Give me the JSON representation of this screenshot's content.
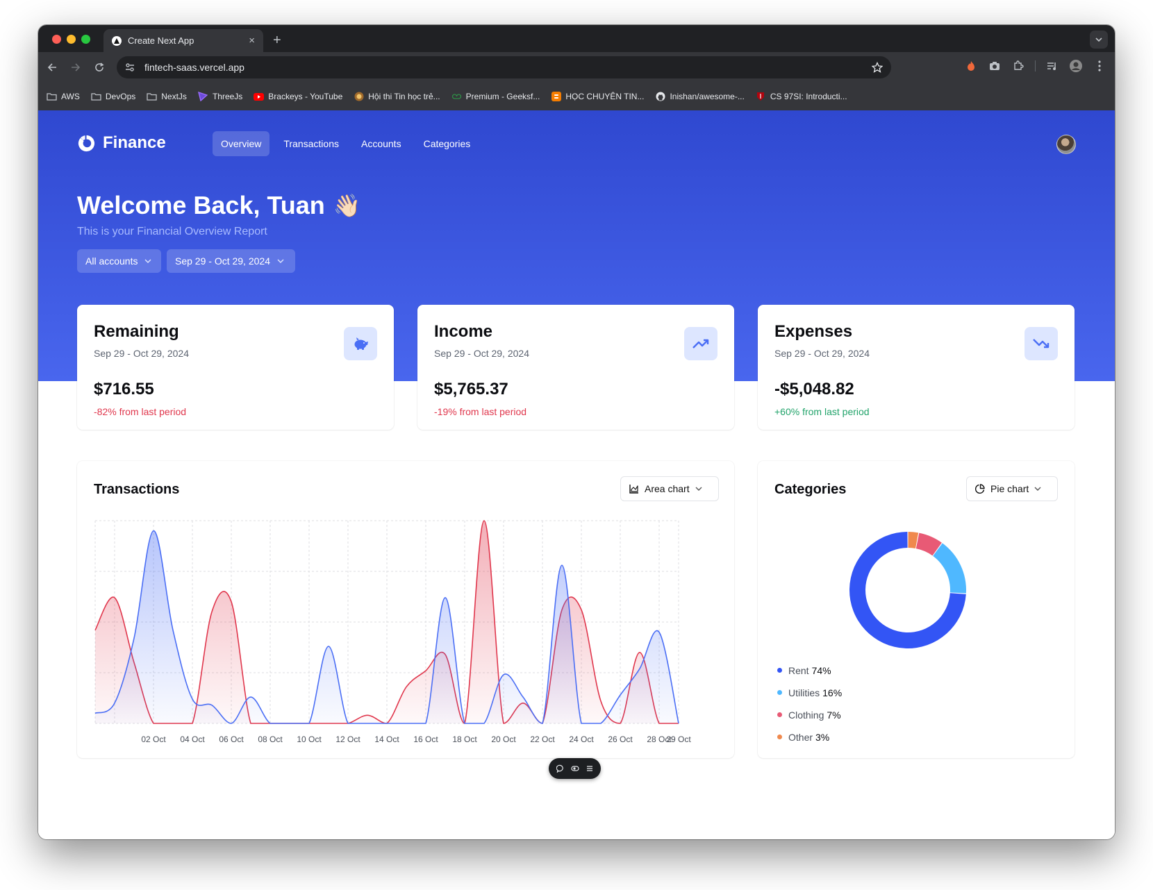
{
  "browser": {
    "tab_title": "Create Next App",
    "tab_close": "×",
    "new_tab": "+",
    "url": "fintech-saas.vercel.app",
    "bookmarks": [
      {
        "label": "AWS",
        "icon": "folder-icon"
      },
      {
        "label": "DevOps",
        "icon": "folder-icon"
      },
      {
        "label": "NextJs",
        "icon": "folder-icon"
      },
      {
        "label": "ThreeJs",
        "icon": "threejs-icon"
      },
      {
        "label": "Brackeys - YouTube",
        "icon": "youtube-icon"
      },
      {
        "label": "Hội thi Tin học trẻ...",
        "icon": "award-icon"
      },
      {
        "label": "Premium - Geeksf...",
        "icon": "geeksforgeeks-icon"
      },
      {
        "label": "HỌC CHUYÊN TIN...",
        "icon": "blogger-icon"
      },
      {
        "label": "Inishan/awesome-...",
        "icon": "github-icon"
      },
      {
        "label": "CS 97SI: Introducti...",
        "icon": "stanford-icon"
      }
    ]
  },
  "app": {
    "brand": "Finance",
    "nav": [
      "Overview",
      "Transactions",
      "Accounts",
      "Categories"
    ],
    "active_nav": "Overview",
    "welcome": "Welcome Back, Tuan",
    "welcome_emoji": "👋🏻",
    "subtitle": "This is your Financial Overview Report",
    "filters": {
      "account": "All accounts",
      "date_range": "Sep 29 - Oct 29, 2024"
    }
  },
  "stats": [
    {
      "title": "Remaining",
      "range": "Sep 29 - Oct 29, 2024",
      "value": "$716.55",
      "change": "-82% from last period",
      "trend": "negative",
      "icon": "piggy-bank-icon"
    },
    {
      "title": "Income",
      "range": "Sep 29 - Oct 29, 2024",
      "value": "$5,765.37",
      "change": "-19% from last period",
      "trend": "negative",
      "icon": "trending-up-icon"
    },
    {
      "title": "Expenses",
      "range": "Sep 29 - Oct 29, 2024",
      "value": "-$5,048.82",
      "change": "+60% from last period",
      "trend": "positive",
      "icon": "trending-down-icon"
    }
  ],
  "transactions_panel": {
    "title": "Transactions",
    "chart_type_label": "Area chart"
  },
  "categories_panel": {
    "title": "Categories",
    "chart_type_label": "Pie chart"
  },
  "colors": {
    "income": "#4a6ef5",
    "expenses": "#e0364c",
    "rent": "#3355f5",
    "utilities": "#4fb8ff",
    "clothing": "#e85a75",
    "other": "#f0894d"
  },
  "chart_data": [
    {
      "type": "area",
      "x_ticks": [
        "02 Oct",
        "04 Oct",
        "06 Oct",
        "08 Oct",
        "10 Oct",
        "12 Oct",
        "14 Oct",
        "16 Oct",
        "18 Oct",
        "20 Oct",
        "22 Oct",
        "24 Oct",
        "26 Oct",
        "28 Oct",
        "29 Oct"
      ],
      "x": [
        "Sep 29",
        "Sep 30",
        "Oct 01",
        "Oct 02",
        "Oct 03",
        "Oct 04",
        "Oct 05",
        "Oct 06",
        "Oct 07",
        "Oct 08",
        "Oct 09",
        "Oct 10",
        "Oct 11",
        "Oct 12",
        "Oct 13",
        "Oct 14",
        "Oct 15",
        "Oct 16",
        "Oct 17",
        "Oct 18",
        "Oct 19",
        "Oct 20",
        "Oct 21",
        "Oct 22",
        "Oct 23",
        "Oct 24",
        "Oct 25",
        "Oct 26",
        "Oct 27",
        "Oct 28",
        "Oct 29"
      ],
      "ylim": [
        0,
        1000
      ],
      "grid": true,
      "series": [
        {
          "key": "income",
          "values": [
            50,
            100,
            420,
            950,
            460,
            120,
            90,
            0,
            130,
            0,
            0,
            0,
            380,
            0,
            0,
            0,
            0,
            0,
            620,
            0,
            0,
            240,
            130,
            0,
            780,
            0,
            0,
            140,
            270,
            450,
            0
          ]
        },
        {
          "key": "expenses",
          "values": [
            460,
            620,
            300,
            0,
            0,
            0,
            550,
            600,
            0,
            0,
            0,
            0,
            0,
            0,
            40,
            0,
            180,
            260,
            340,
            0,
            1000,
            0,
            100,
            0,
            560,
            560,
            110,
            0,
            350,
            0,
            0
          ]
        }
      ]
    },
    {
      "type": "pie",
      "slices": [
        {
          "label": "Rent",
          "value": 74,
          "pct_label": "74%"
        },
        {
          "label": "Utilities",
          "value": 16,
          "pct_label": "16%"
        },
        {
          "label": "Clothing",
          "value": 7,
          "pct_label": "7%"
        },
        {
          "label": "Other",
          "value": 3,
          "pct_label": "3%"
        }
      ]
    }
  ]
}
